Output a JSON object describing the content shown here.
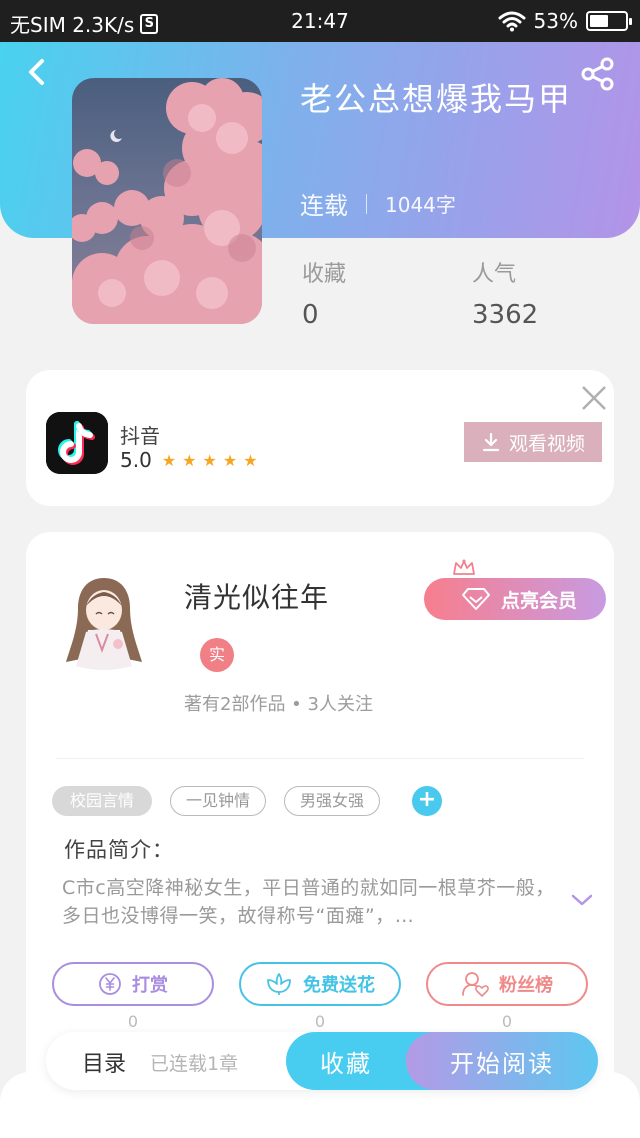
{
  "status_bar": {
    "carrier": "无SIM 2.3K/s",
    "s_icon": "S",
    "time": "21:47",
    "battery": "53%",
    "battery_level": 0.53
  },
  "book": {
    "title": "老公总想爆我马甲",
    "status": "连载",
    "word_count": "1044字",
    "favorites_label": "收藏",
    "favorites_value": "0",
    "popularity_label": "人气",
    "popularity_value": "3362"
  },
  "ad": {
    "app_name": "抖音",
    "rating": "5.0",
    "stars": "★★★★★",
    "button_label": "观看视频"
  },
  "author": {
    "name": "清光似往年",
    "badge": "实",
    "stats": "著有2部作品 • 3人关注",
    "vip_label": "点亮会员"
  },
  "tags": [
    "校园言情",
    "一见钟情",
    "男强女强"
  ],
  "tag_add": "+",
  "intro": {
    "title": "作品简介：",
    "text": "C市c高空降神秘女生，平日普通的就如同一根草芥一般，多日也没博得一笑，故得称号“面瘫”，…"
  },
  "actions": [
    {
      "label": "打赏",
      "count": "0",
      "color": "#a98de0",
      "icon": "yen-icon"
    },
    {
      "label": "免费送花",
      "count": "0",
      "color": "#45c3e6",
      "icon": "flower-icon"
    },
    {
      "label": "粉丝榜",
      "count": "0",
      "color": "#f08a8a",
      "icon": "fans-icon"
    }
  ],
  "bottom_bar": {
    "toc_label": "目录",
    "toc_progress": "已连载1章",
    "collect_label": "收藏",
    "read_label": "开始阅读"
  }
}
